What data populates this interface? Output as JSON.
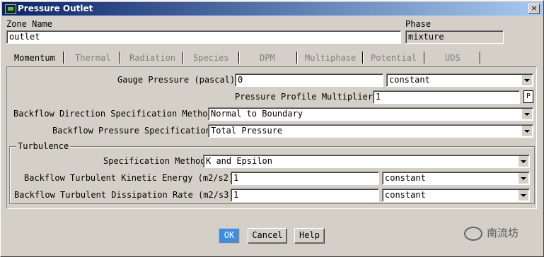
{
  "window": {
    "title": "Pressure Outlet",
    "close_label": "×"
  },
  "zone": {
    "label": "Zone Name",
    "value": "outlet"
  },
  "phase": {
    "label": "Phase",
    "value": "mixture"
  },
  "tabs": [
    {
      "label": "Momentum",
      "active": true
    },
    {
      "label": "Thermal",
      "active": false
    },
    {
      "label": "Radiation",
      "active": false
    },
    {
      "label": "Species",
      "active": false
    },
    {
      "label": "DPM",
      "active": false
    },
    {
      "label": "Multiphase",
      "active": false
    },
    {
      "label": "Potential",
      "active": false
    },
    {
      "label": "UDS",
      "active": false
    }
  ],
  "momentum": {
    "gauge_pressure": {
      "label": "Gauge Pressure (pascal)",
      "value": "0",
      "method": "constant"
    },
    "profile_multiplier": {
      "label": "Pressure Profile Multiplier",
      "value": "1",
      "p_label": "P"
    },
    "backflow_direction": {
      "label": "Backflow Direction Specification Method",
      "value": "Normal to Boundary"
    },
    "backflow_pressure": {
      "label": "Backflow Pressure Specification",
      "value": "Total Pressure"
    }
  },
  "turbulence": {
    "title": "Turbulence",
    "spec_method": {
      "label": "Specification Method",
      "value": "K and Epsilon"
    },
    "tke": {
      "label": "Backflow Turbulent Kinetic Energy (m2/s2)",
      "value": "1",
      "method": "constant"
    },
    "tdr": {
      "label": "Backflow Turbulent Dissipation Rate (m2/s3)",
      "value": "1",
      "method": "constant"
    }
  },
  "buttons": {
    "ok": "OK",
    "cancel": "Cancel",
    "help": "Help"
  },
  "watermark": {
    "text": "南流坊"
  }
}
